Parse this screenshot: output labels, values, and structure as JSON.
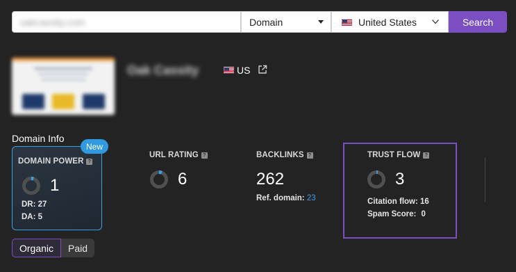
{
  "search": {
    "input_value": "oakcassity.com",
    "type_select": "Domain",
    "country_select": "United States",
    "button_label": "Search"
  },
  "site": {
    "name": "Oak Cassity",
    "country_code": "US"
  },
  "domain_info": {
    "title": "Domain Info",
    "new_badge": "New",
    "domain_power": {
      "label": "DOMAIN POWER",
      "value": "1",
      "dr_text": "DR: 27",
      "da_text": "DA: 5"
    },
    "url_rating": {
      "label": "URL RATING",
      "value": "6"
    },
    "backlinks": {
      "label": "BACKLINKS",
      "value": "262",
      "ref_label": "Ref. domain:",
      "ref_value": "23"
    },
    "trust_flow": {
      "label": "TRUST FLOW",
      "value": "3",
      "citation_text": "Citation flow: 16",
      "spam_label": "Spam Score:",
      "spam_value": "0"
    }
  },
  "toggle": {
    "organic": "Organic",
    "paid": "Paid"
  },
  "icons": {
    "help": "question-icon",
    "external": "external-link-icon",
    "flag": "us-flag-icon",
    "caret": "caret-down-icon",
    "chevron": "chevron-down-icon"
  },
  "colors": {
    "accent_purple": "#7b4fc2",
    "accent_blue": "#3aa0e6",
    "background": "#232323"
  }
}
